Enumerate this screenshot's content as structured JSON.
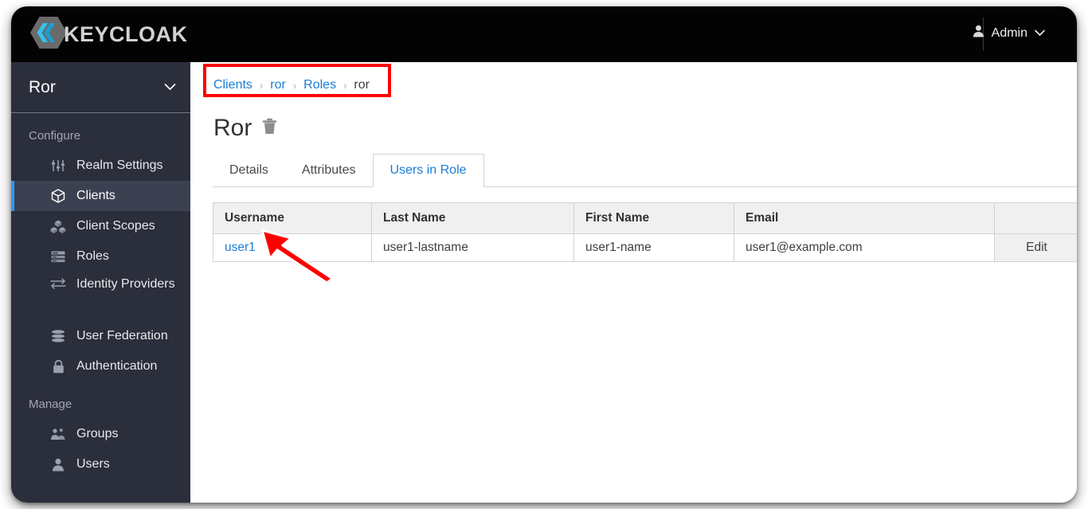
{
  "masthead": {
    "brand_name": "KEYCLOAK",
    "brand_icon": "keycloak-hexagon-logo",
    "user_icon": "user-avatar-icon",
    "user_name": "Admin",
    "user_caret_icon": "chevron-down-icon"
  },
  "sidebar": {
    "realm": {
      "name": "Ror",
      "caret_icon": "chevron-down-icon"
    },
    "sections": [
      {
        "label": "Configure",
        "items": [
          {
            "label": "Realm Settings",
            "icon": "sliders-icon",
            "active": false
          },
          {
            "label": "Clients",
            "icon": "cube-icon",
            "active": true
          },
          {
            "label": "Client Scopes",
            "icon": "cubes-icon",
            "active": false
          },
          {
            "label": "Roles",
            "icon": "list-rows-icon",
            "active": false
          },
          {
            "label": "Identity Providers",
            "icon": "exchange-arrows-icon",
            "active": false
          },
          {
            "label": "User Federation",
            "icon": "database-icon",
            "active": false
          },
          {
            "label": "Authentication",
            "icon": "lock-icon",
            "active": false
          }
        ]
      },
      {
        "label": "Manage",
        "items": [
          {
            "label": "Groups",
            "icon": "users-group-icon",
            "active": false
          },
          {
            "label": "Users",
            "icon": "user-icon",
            "active": false
          }
        ]
      }
    ]
  },
  "content": {
    "breadcrumb": {
      "separator": "›",
      "items": [
        {
          "label": "Clients",
          "link": true
        },
        {
          "label": "ror",
          "link": true
        },
        {
          "label": "Roles",
          "link": true
        },
        {
          "label": "ror",
          "link": false
        }
      ]
    },
    "page_title": "Ror",
    "delete_icon": "trash-icon",
    "tabs": [
      {
        "label": "Details",
        "active": false
      },
      {
        "label": "Attributes",
        "active": false
      },
      {
        "label": "Users in Role",
        "active": true
      }
    ],
    "table": {
      "columns": [
        "Username",
        "Last Name",
        "First Name",
        "Email",
        ""
      ],
      "rows": [
        {
          "username": "user1",
          "last_name": "user1-lastname",
          "first_name": "user1-name",
          "email": "user1@example.com",
          "action": "Edit"
        }
      ]
    }
  },
  "annotations": {
    "highlight_color": "#ff0000",
    "arrow_target": "user1",
    "box_target": "breadcrumb"
  },
  "colors": {
    "masthead_bg": "#030303",
    "sidebar_bg": "#2b2e3b",
    "sidebar_active_bg": "#3c4152",
    "accent_blue": "#2b9af3",
    "link_blue": "#1a7ed6",
    "annotation_red": "#ff0000",
    "table_header_bg": "#f0f0f0"
  }
}
